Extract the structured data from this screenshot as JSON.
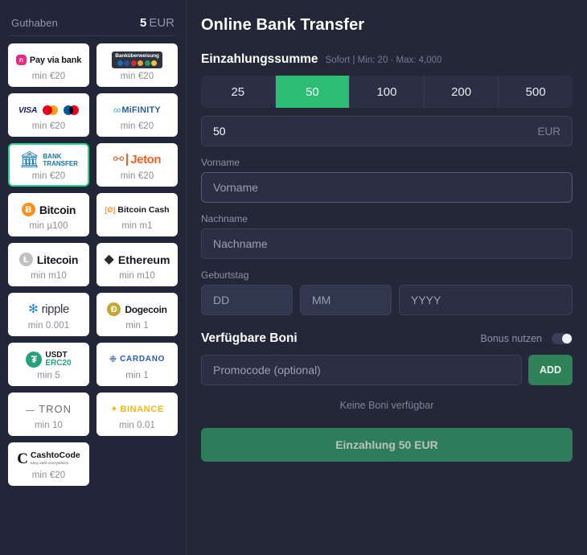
{
  "sidebar": {
    "balance_label": "Guthaben",
    "balance_value": "5",
    "balance_currency": "EUR",
    "footnote": "",
    "methods": [
      {
        "name": "Pay via bank",
        "logo": "payviabank-logo",
        "min": "min €20",
        "selected": false
      },
      {
        "name": "Banküberweisung",
        "logo": "bankueberweisung-logo",
        "min": "min €20",
        "selected": false
      },
      {
        "name": "VISA / Mastercard / Maestro",
        "logo": "cards-logo",
        "min": "min €20",
        "selected": false
      },
      {
        "name": "MiFinity",
        "logo": "mifinity-logo",
        "min": "min €20",
        "selected": false
      },
      {
        "name": "Bank Transfer",
        "logo": "banktransfer-logo",
        "min": "min €20",
        "selected": true
      },
      {
        "name": "Jeton",
        "logo": "jeton-logo",
        "min": "min €20",
        "selected": false
      },
      {
        "name": "Bitcoin",
        "logo": "bitcoin-logo",
        "min": "min µ100",
        "selected": false
      },
      {
        "name": "Bitcoin Cash",
        "logo": "bitcoincash-logo",
        "min": "min m1",
        "selected": false
      },
      {
        "name": "Litecoin",
        "logo": "litecoin-logo",
        "min": "min m10",
        "selected": false
      },
      {
        "name": "Ethereum",
        "logo": "ethereum-logo",
        "min": "min m10",
        "selected": false
      },
      {
        "name": "ripple",
        "logo": "ripple-logo",
        "min": "min 0.001",
        "selected": false
      },
      {
        "name": "Dogecoin",
        "logo": "dogecoin-logo",
        "min": "min 1",
        "selected": false
      },
      {
        "name": "USDT ERC20",
        "logo": "usdt-logo",
        "min": "min 5",
        "selected": false
      },
      {
        "name": "CARDANO",
        "logo": "cardano-logo",
        "min": "min 1",
        "selected": false
      },
      {
        "name": "TRON",
        "logo": "tron-logo",
        "min": "min 10",
        "selected": false
      },
      {
        "name": "BINANCE",
        "logo": "binance-logo",
        "min": "min 0.01",
        "selected": false
      },
      {
        "name": "CashtoCode",
        "logo": "cashtocode-logo",
        "min": "min €20",
        "selected": false
      }
    ],
    "labels": {
      "payviabank": "Pay via bank",
      "payviabank_mark": "n",
      "bankueberweisung": "Banküberweisung",
      "visa": "VISA",
      "mifinity": "MiFINITY",
      "banktransfer_l1": "BANK",
      "banktransfer_l2": "TRANSFER",
      "jeton": "Jeton",
      "bitcoin": "Bitcoin",
      "bitcoin_mark": "Ƀ",
      "bitcoincash_tag": "[Ø]",
      "bitcoincash": "Bitcoin Cash",
      "litecoin": "Litecoin",
      "litecoin_mark": "Ł",
      "ethereum": "Ethereum",
      "ripple": "ripple",
      "dogecoin": "Dogecoin",
      "dogecoin_mark": "Ð",
      "usdt_1": "USDT",
      "usdt_2": "ERC20",
      "usdt_mark": "₮",
      "cardano": "CARDANO",
      "tron": "TRON",
      "binance": "BINANCE",
      "cashtocode_1": "CashtoCode",
      "cashtocode_2": "easy.safe.everywhere.",
      "cashtocode_mark": "C"
    }
  },
  "main": {
    "title": "Online Bank Transfer",
    "amount_section_title": "Einzahlungssumme",
    "amount_section_note": "Sofort | Min: 20 · Max: 4,000",
    "quick_amounts": [
      "25",
      "50",
      "100",
      "200",
      "500"
    ],
    "selected_amount": "50",
    "amount_value": "50",
    "amount_currency": "EUR",
    "first_name_label": "Vorname",
    "first_name_placeholder": "Vorname",
    "first_name_value": "",
    "last_name_label": "Nachname",
    "last_name_placeholder": "Nachname",
    "last_name_value": "",
    "dob_label": "Geburtstag",
    "dob_day_placeholder": "DD",
    "dob_month_placeholder": "MM",
    "dob_year_placeholder": "YYYY",
    "bonus_title": "Verfügbare Boni",
    "bonus_toggle_label": "Bonus nutzen",
    "bonus_toggle_on": false,
    "promocode_placeholder": "Promocode (optional)",
    "add_button": "ADD",
    "no_bonus_text": "Keine Boni verfügbar",
    "deposit_button": "Einzahlung 50 EUR"
  },
  "colors": {
    "accent_green": "#2bbd73",
    "selected_border": "#2bd488",
    "add_button": "#2f8157",
    "deposit_button": "#2e7d5a",
    "panel_bg": "#232738",
    "field_bg": "#2b2f44"
  }
}
